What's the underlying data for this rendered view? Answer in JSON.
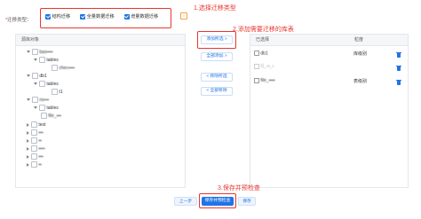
{
  "form": {
    "required_mark": "*",
    "type_label": "迁移类型：",
    "options": [
      {
        "label": "结构迁移",
        "checked": true
      },
      {
        "label": "全量数据迁移",
        "checked": true
      },
      {
        "label": "增量数据迁移",
        "checked": true
      }
    ],
    "info_badge": "i"
  },
  "annotations": {
    "step1": "1.选择迁移类型",
    "step2": "2.添加需要迁移的库表",
    "step3": "3.保存并预检查"
  },
  "source_panel": {
    "header": "源库对象",
    "tree": [
      {
        "label": "bas▪▪▪▪",
        "level": 0
      },
      {
        "label": "tables",
        "level": 1
      },
      {
        "label": "chec▪▪▪▪",
        "level": 2
      },
      {
        "label": "db1",
        "level": 0
      },
      {
        "label": "tables",
        "level": 1
      },
      {
        "label": "t1",
        "level": 2
      },
      {
        "label": "ns▪▪▪",
        "level": 0
      },
      {
        "label": "tables",
        "level": 1
      },
      {
        "label": "file_▪▪▪",
        "level": 2
      },
      {
        "label": "test",
        "level": 0
      },
      {
        "label": "▪▪▪",
        "level": 0
      },
      {
        "label": "▪▪",
        "level": 0
      },
      {
        "label": "▪▪▪▪",
        "level": 0
      },
      {
        "label": "▪▪▪",
        "level": 0
      },
      {
        "label": "▪▪",
        "level": 0
      }
    ]
  },
  "middle_buttons": {
    "add_selected": "添加所选 >",
    "add_all": "全部添加 >",
    "remove_selected": "< 移除所选",
    "remove_all": "< 全部移除"
  },
  "target_panel": {
    "header_name": "已选择",
    "header_granularity": "粒度",
    "rows": [
      {
        "name": "db1",
        "granularity": "库级别"
      },
      {
        "name": "t1_▪▪_▪",
        "granularity": ""
      },
      {
        "name": "file_▪▪▪▪",
        "granularity": "表级别"
      }
    ]
  },
  "footer": {
    "prev": "上一步",
    "save_precheck": "保存并预检查",
    "save": "保存"
  },
  "colors": {
    "accent": "#1f74e6",
    "annotation_red": "#e8372f"
  }
}
